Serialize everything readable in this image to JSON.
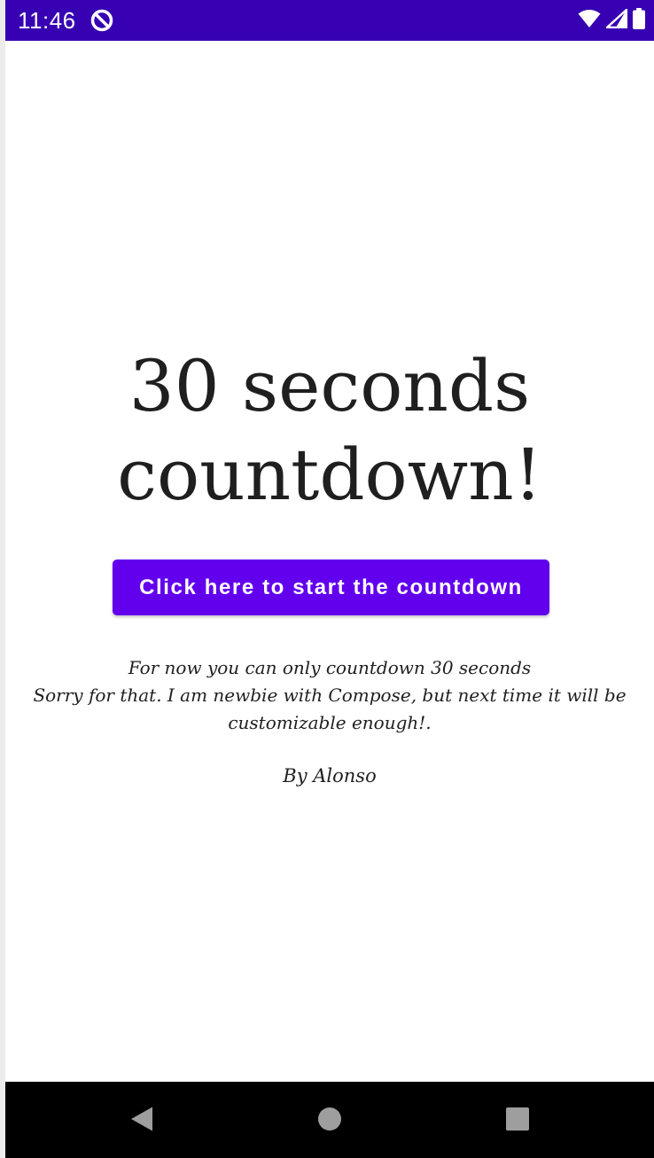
{
  "status_bar": {
    "time": "11:46",
    "background_color": "#3700b3",
    "icons": [
      "app-notification-icon",
      "wifi-icon",
      "signal-icon",
      "battery-icon"
    ]
  },
  "main": {
    "headline_line1": "30 seconds",
    "headline_line2": "countdown!",
    "start_button_label": "Click here to start the countdown",
    "start_button_color": "#6200ee",
    "note_line1": "For now you can only countdown 30 seconds",
    "note_line2": "Sorry for that. I am newbie with Compose, but next time it will be",
    "note_line3": "customizable enough!.",
    "author": "By Alonso"
  },
  "nav_bar": {
    "icons": [
      "back-icon",
      "home-icon",
      "recents-icon"
    ]
  }
}
